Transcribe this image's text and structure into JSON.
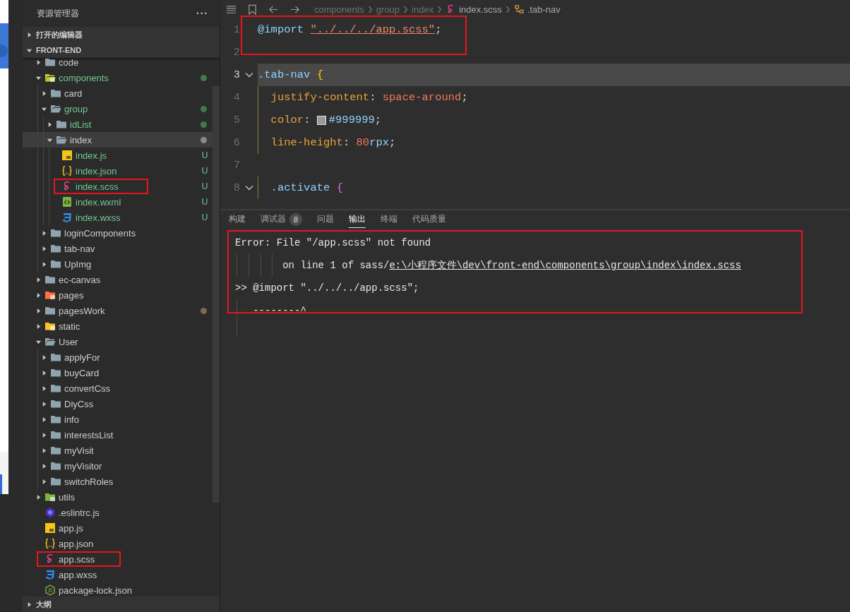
{
  "explorer": {
    "title": "资源管理器",
    "more": "···",
    "sections": [
      {
        "label": "打开的编辑器",
        "expanded": false
      },
      {
        "label": "FRONT-END",
        "expanded": true
      }
    ],
    "tree": [
      {
        "name": "code",
        "kind": "folder",
        "expanded": false,
        "untracked": false,
        "selected": false,
        "highlighted": false
      },
      {
        "name": "components",
        "kind": "folder-components",
        "expanded": true,
        "untracked": true,
        "selected": false,
        "highlighted": false,
        "color": "#3f7a4c",
        "children": [
          {
            "name": "card",
            "kind": "folder",
            "expanded": false,
            "untracked": false,
            "selected": false,
            "highlighted": false
          },
          {
            "name": "group",
            "kind": "folder",
            "expanded": true,
            "untracked": true,
            "selected": false,
            "highlighted": false,
            "color": "#3f7a4c",
            "children": [
              {
                "name": "idList",
                "kind": "folder",
                "expanded": false,
                "untracked": true,
                "selected": false,
                "highlighted": false,
                "color": "#3f7a4c"
              },
              {
                "name": "index",
                "kind": "folder",
                "expanded": true,
                "untracked": false,
                "selected": true,
                "highlighted": false,
                "color": "#8a8a8a",
                "children": [
                  {
                    "name": "index.js",
                    "kind": "js",
                    "untracked": true,
                    "selected": false,
                    "highlighted": false,
                    "badge": "U"
                  },
                  {
                    "name": "index.json",
                    "kind": "json",
                    "untracked": true,
                    "selected": false,
                    "highlighted": false,
                    "badge": "U"
                  },
                  {
                    "name": "index.scss",
                    "kind": "scss",
                    "untracked": true,
                    "selected": false,
                    "highlighted": true,
                    "badge": "U"
                  },
                  {
                    "name": "index.wxml",
                    "kind": "wxml",
                    "untracked": true,
                    "selected": false,
                    "highlighted": false,
                    "badge": "U"
                  },
                  {
                    "name": "index.wxss",
                    "kind": "wxss",
                    "untracked": true,
                    "selected": false,
                    "highlighted": false,
                    "badge": "U"
                  }
                ]
              }
            ]
          },
          {
            "name": "loginComponents",
            "kind": "folder",
            "expanded": false,
            "untracked": false,
            "selected": false,
            "highlighted": false
          },
          {
            "name": "tab-nav",
            "kind": "folder",
            "expanded": false,
            "untracked": false,
            "selected": false,
            "highlighted": false
          },
          {
            "name": "UpImg",
            "kind": "folder",
            "expanded": false,
            "untracked": false,
            "selected": false,
            "highlighted": false
          }
        ]
      },
      {
        "name": "ec-canvas",
        "kind": "folder",
        "expanded": false,
        "untracked": false,
        "selected": false,
        "highlighted": false
      },
      {
        "name": "pages",
        "kind": "folder-pages",
        "expanded": false,
        "untracked": false,
        "selected": false,
        "highlighted": false
      },
      {
        "name": "pagesWork",
        "kind": "folder",
        "expanded": false,
        "untracked": false,
        "selected": false,
        "highlighted": false,
        "color": "#7a6a4e"
      },
      {
        "name": "static",
        "kind": "folder-static",
        "expanded": false,
        "untracked": false,
        "selected": false,
        "highlighted": false
      },
      {
        "name": "User",
        "kind": "folder",
        "expanded": true,
        "untracked": false,
        "selected": false,
        "highlighted": false,
        "children": [
          {
            "name": "applyFor",
            "kind": "folder",
            "expanded": false,
            "untracked": false,
            "selected": false,
            "highlighted": false
          },
          {
            "name": "buyCard",
            "kind": "folder",
            "expanded": false,
            "untracked": false,
            "selected": false,
            "highlighted": false
          },
          {
            "name": "convertCss",
            "kind": "folder",
            "expanded": false,
            "untracked": false,
            "selected": false,
            "highlighted": false
          },
          {
            "name": "DiyCss",
            "kind": "folder",
            "expanded": false,
            "untracked": false,
            "selected": false,
            "highlighted": false
          },
          {
            "name": "info",
            "kind": "folder",
            "expanded": false,
            "untracked": false,
            "selected": false,
            "highlighted": false
          },
          {
            "name": "interestsList",
            "kind": "folder",
            "expanded": false,
            "untracked": false,
            "selected": false,
            "highlighted": false
          },
          {
            "name": "myVisit",
            "kind": "folder",
            "expanded": false,
            "untracked": false,
            "selected": false,
            "highlighted": false
          },
          {
            "name": "myVisitor",
            "kind": "folder",
            "expanded": false,
            "untracked": false,
            "selected": false,
            "highlighted": false
          },
          {
            "name": "switchRoles",
            "kind": "folder",
            "expanded": false,
            "untracked": false,
            "selected": false,
            "highlighted": false
          }
        ]
      },
      {
        "name": "utils",
        "kind": "folder-utils",
        "expanded": false,
        "untracked": false,
        "selected": false,
        "highlighted": false
      },
      {
        "name": ".eslintrc.js",
        "kind": "eslint",
        "untracked": false,
        "selected": false,
        "highlighted": false
      },
      {
        "name": "app.js",
        "kind": "js",
        "untracked": false,
        "selected": false,
        "highlighted": false
      },
      {
        "name": "app.json",
        "kind": "json",
        "untracked": false,
        "selected": false,
        "highlighted": false
      },
      {
        "name": "app.scss",
        "kind": "scss",
        "untracked": false,
        "selected": false,
        "highlighted": true
      },
      {
        "name": "app.wxss",
        "kind": "wxss",
        "untracked": false,
        "selected": false,
        "highlighted": false
      },
      {
        "name": "package-lock.json",
        "kind": "node",
        "untracked": false,
        "selected": false,
        "highlighted": false
      }
    ],
    "outline": {
      "label": "大纲",
      "expanded": false
    }
  },
  "breadcrumb": [
    {
      "text": "components",
      "kind": "plain"
    },
    {
      "text": "group",
      "kind": "plain"
    },
    {
      "text": "index",
      "kind": "plain"
    },
    {
      "text": "index.scss",
      "kind": "scss"
    },
    {
      "text": ".tab-nav",
      "kind": "symbol"
    }
  ],
  "code": {
    "highlighted_lines": true,
    "lines": [
      {
        "number": "1",
        "fold": false,
        "current": false,
        "tokens": [
          {
            "text": "@import ",
            "kind": "keyword"
          },
          {
            "text": "\"../../../app.scss\"",
            "kind": "link-string"
          },
          {
            "text": ";",
            "kind": "punct"
          }
        ]
      },
      {
        "number": "2",
        "fold": false,
        "current": false
      },
      {
        "number": "3",
        "fold": true,
        "current": true,
        "tokens": [
          {
            "text": ".tab-nav ",
            "kind": "selector"
          },
          {
            "text": "{",
            "kind": "brace"
          }
        ]
      },
      {
        "number": "4",
        "fold": false,
        "current": false,
        "tokens": [
          {
            "text": "  justify-content",
            "kind": "property"
          },
          {
            "text": ": ",
            "kind": "punct"
          },
          {
            "text": "space-around",
            "kind": "value"
          },
          {
            "text": ";",
            "kind": "punct"
          }
        ]
      },
      {
        "number": "5",
        "fold": false,
        "current": false,
        "tokens": [
          {
            "text": "  color",
            "kind": "property"
          },
          {
            "text": ": ",
            "kind": "punct"
          },
          {
            "kind": "swatch",
            "color": "#999999"
          },
          {
            "text": "#999999",
            "kind": "hex"
          },
          {
            "text": ";",
            "kind": "punct"
          }
        ]
      },
      {
        "number": "6",
        "fold": false,
        "current": false,
        "tokens": [
          {
            "text": "  line-height",
            "kind": "property"
          },
          {
            "text": ": ",
            "kind": "punct"
          },
          {
            "text": "80",
            "kind": "number"
          },
          {
            "text": "rpx",
            "kind": "unit"
          },
          {
            "text": ";",
            "kind": "punct"
          }
        ]
      },
      {
        "number": "7",
        "fold": false,
        "current": false
      },
      {
        "number": "8",
        "fold": true,
        "current": false,
        "tokens": [
          {
            "text": "  .activate ",
            "kind": "selector"
          },
          {
            "text": "{",
            "kind": "brace2"
          }
        ]
      }
    ]
  },
  "panel": {
    "tabs": [
      {
        "label": "构建",
        "selected": false
      },
      {
        "label": "调试器",
        "selected": false,
        "badge": "8"
      },
      {
        "label": "问题",
        "selected": false
      },
      {
        "label": "输出",
        "selected": true
      },
      {
        "label": "终端",
        "selected": false
      },
      {
        "label": "代码质量",
        "selected": false
      }
    ],
    "output": [
      {
        "kind": "text",
        "text": "Error: File \"/app.scss\" not found"
      },
      {
        "kind": "path",
        "text": "        on line 1 of sass/",
        "link": "e:\\小程序文件\\dev\\front-end\\components\\group\\index\\index.scss"
      },
      {
        "kind": "text",
        "text": ">> @import \"../../../app.scss\";"
      },
      {
        "kind": "text",
        "text": "   --------^"
      }
    ],
    "output_highlighted": true
  }
}
